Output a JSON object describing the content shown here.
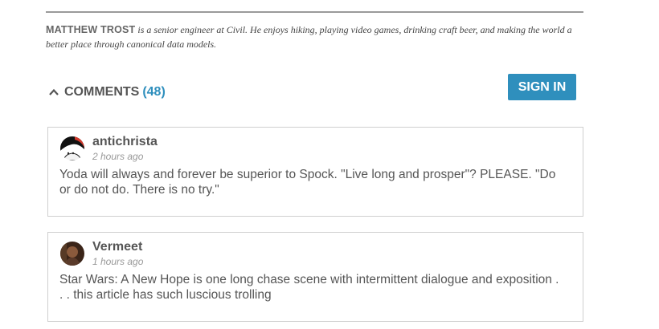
{
  "author_bio": {
    "name": "MATTHEW TROST",
    "text": " is a senior engineer at Civil. He enjoys hiking, playing video games, drinking craft beer, and making the world a better place through canonical data models."
  },
  "comments_section": {
    "label": "COMMENTS",
    "count": "(48)",
    "toggle_icon": "chevron-up-icon",
    "sign_in_label": "SIGN IN",
    "accent_color": "#2f8fbd"
  },
  "comments": [
    {
      "author": "antichrista",
      "time": "2 hours ago",
      "text": "Yoda will always and forever be superior to Spock. \"Live long and prosper\"? PLEASE. \"Do or do not do. There is no try.\"",
      "avatar_icon": "cartoon-face-avatar"
    },
    {
      "author": "Vermeet",
      "time": "1 hours ago",
      "text": "Star Wars: A New Hope is one long chase scene with intermittent dialogue and exposition . . . this article has such luscious trolling",
      "avatar_icon": "photo-avatar"
    }
  ]
}
